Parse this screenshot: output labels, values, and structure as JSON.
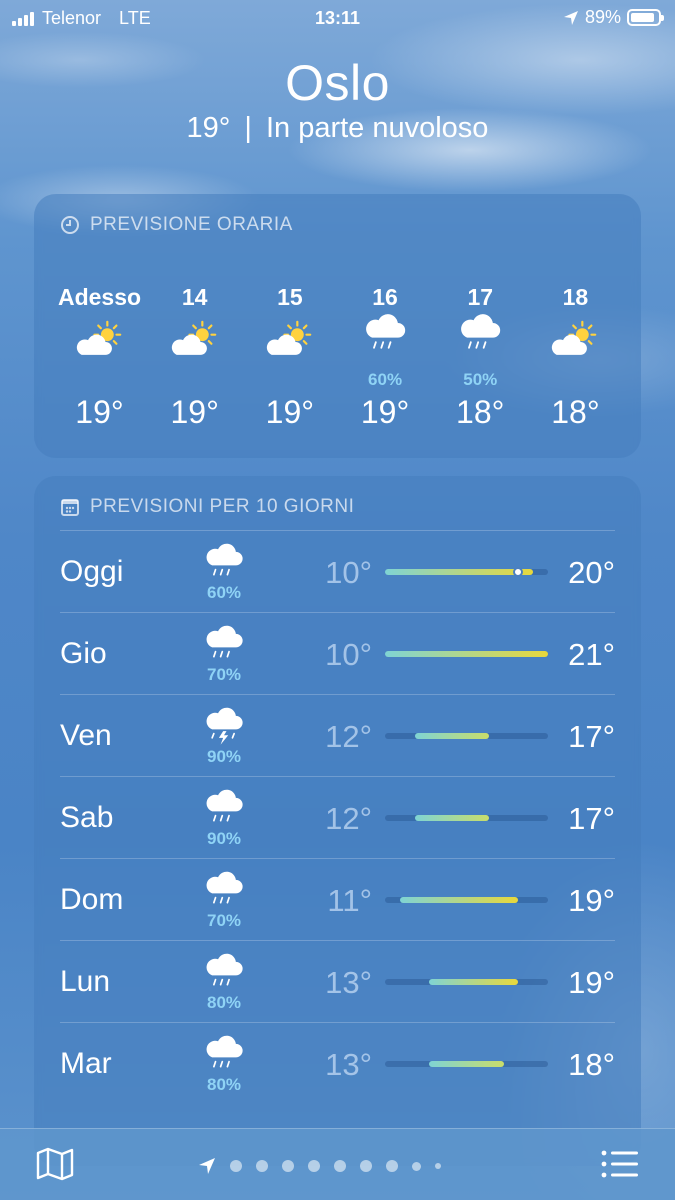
{
  "status_bar": {
    "carrier": "Telenor",
    "network": "LTE",
    "time": "13:11",
    "battery": "89%",
    "battery_level": 0.89
  },
  "location": {
    "city": "Oslo",
    "current_temp": "19°",
    "separator": "|",
    "condition": "In parte nuvoloso"
  },
  "hourly": {
    "title": "PREVISIONE ORARIA",
    "hours": [
      {
        "label": "Adesso",
        "icon": "partly-cloudy-icon",
        "pct": "",
        "temp": "19°"
      },
      {
        "label": "14",
        "icon": "partly-cloudy-icon",
        "pct": "",
        "temp": "19°"
      },
      {
        "label": "15",
        "icon": "partly-cloudy-icon",
        "pct": "",
        "temp": "19°"
      },
      {
        "label": "16",
        "icon": "rain-icon",
        "pct": "60%",
        "temp": "19°"
      },
      {
        "label": "17",
        "icon": "rain-icon",
        "pct": "50%",
        "temp": "18°"
      },
      {
        "label": "18",
        "icon": "partly-cloudy-icon",
        "pct": "",
        "temp": "18°"
      }
    ]
  },
  "daily": {
    "title": "PREVISIONI PER 10 GIORNI",
    "range_min": 10,
    "range_max": 21,
    "current_temp_value": 19,
    "days": [
      {
        "name": "Oggi",
        "icon": "rain-icon",
        "pct": "60%",
        "low": "10°",
        "high": "20°",
        "low_v": 10,
        "high_v": 20
      },
      {
        "name": "Gio",
        "icon": "rain-icon",
        "pct": "70%",
        "low": "10°",
        "high": "21°",
        "low_v": 10,
        "high_v": 21
      },
      {
        "name": "Ven",
        "icon": "thunderstorm-icon",
        "pct": "90%",
        "low": "12°",
        "high": "17°",
        "low_v": 12,
        "high_v": 17
      },
      {
        "name": "Sab",
        "icon": "rain-icon",
        "pct": "90%",
        "low": "12°",
        "high": "17°",
        "low_v": 12,
        "high_v": 17
      },
      {
        "name": "Dom",
        "icon": "rain-icon",
        "pct": "70%",
        "low": "11°",
        "high": "19°",
        "low_v": 11,
        "high_v": 19
      },
      {
        "name": "Lun",
        "icon": "rain-icon",
        "pct": "80%",
        "low": "13°",
        "high": "19°",
        "low_v": 13,
        "high_v": 19
      },
      {
        "name": "Mar",
        "icon": "rain-icon",
        "pct": "80%",
        "low": "13°",
        "high": "18°",
        "low_v": 13,
        "high_v": 18
      }
    ]
  },
  "bottom_bar": {
    "map_icon": "map-icon",
    "location_icon": "location-arrow-icon",
    "list_icon": "list-icon",
    "page_dots": 9
  },
  "colors": {
    "precip_blue": "#8fd3f5",
    "bar_cool": "#7fd4d4",
    "bar_warm": "#e8d83c",
    "sun": "#ffd23f"
  }
}
